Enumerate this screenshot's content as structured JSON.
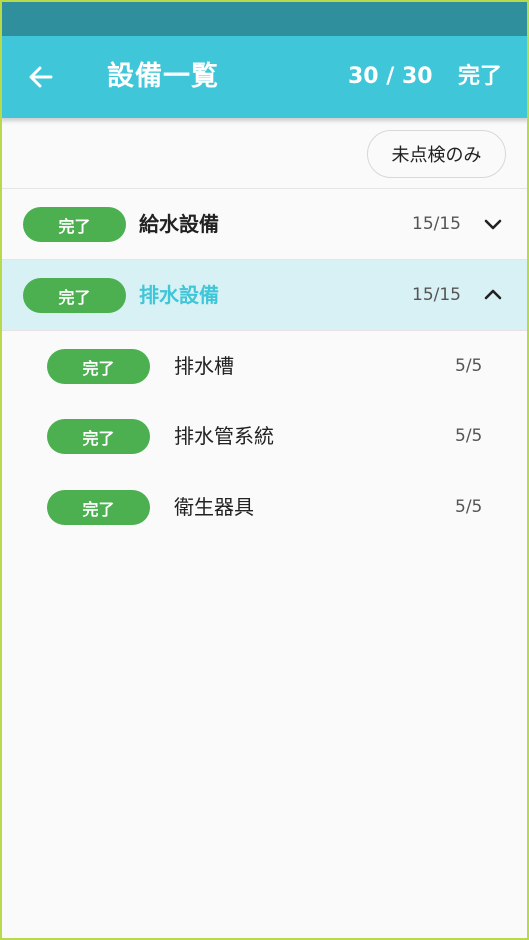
{
  "header": {
    "title": "設備一覧",
    "counter": "30 / 30",
    "done_label": "完了"
  },
  "filter": {
    "label": "未点検のみ"
  },
  "groups": [
    {
      "badge": "完了",
      "name": "給水設備",
      "count": "15/15",
      "expanded": false
    },
    {
      "badge": "完了",
      "name": "排水設備",
      "count": "15/15",
      "expanded": true,
      "items": [
        {
          "badge": "完了",
          "name": "排水槽",
          "count": "5/5"
        },
        {
          "badge": "完了",
          "name": "排水管系統",
          "count": "5/5"
        },
        {
          "badge": "完了",
          "name": "衛生器具",
          "count": "5/5"
        }
      ]
    }
  ],
  "colors": {
    "status_bar": "#2f8f9c",
    "app_bar": "#3fc6d8",
    "badge": "#4caf50",
    "expanded_row": "#d8f1f4",
    "frame": "#b8d94a"
  }
}
